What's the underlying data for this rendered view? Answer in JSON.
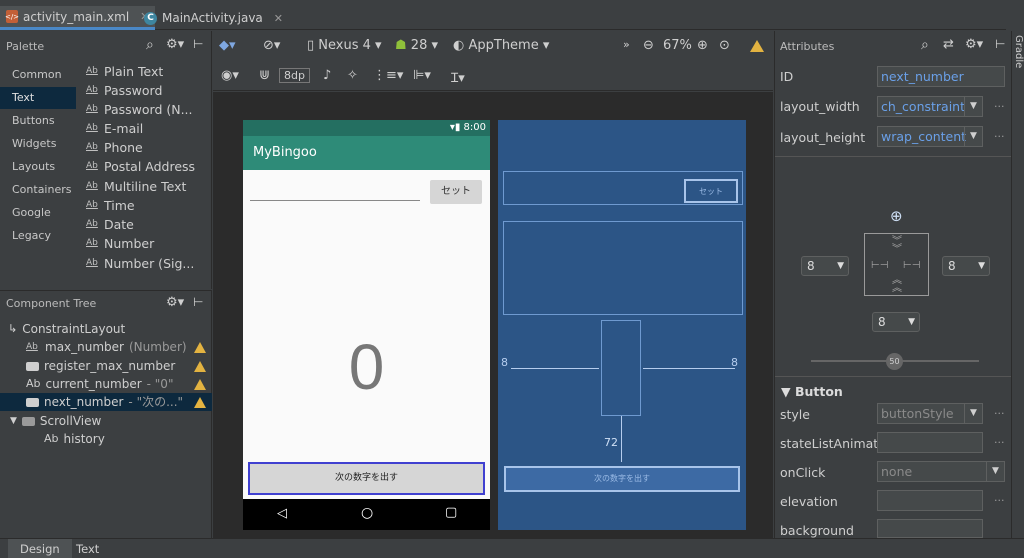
{
  "tabs": [
    {
      "label": "activity_main.xml",
      "icon": "xml-file-icon",
      "active": true
    },
    {
      "label": "MainActivity.java",
      "icon": "java-class-icon",
      "active": false
    }
  ],
  "palette": {
    "title": "Palette",
    "categories": [
      "Common",
      "Text",
      "Buttons",
      "Widgets",
      "Layouts",
      "Containers",
      "Google",
      "Legacy"
    ],
    "selected_category": "Text",
    "items": [
      "Plain Text",
      "Password",
      "Password (N...",
      "E-mail",
      "Phone",
      "Postal Address",
      "Multiline Text",
      "Time",
      "Date",
      "Number",
      "Number (Sig..."
    ]
  },
  "component_tree": {
    "title": "Component Tree",
    "rows": [
      {
        "name": "ConstraintLayout",
        "extra": ""
      },
      {
        "name": "max_number",
        "extra": "(Number)"
      },
      {
        "name": "register_max_number",
        "extra": ""
      },
      {
        "name": "current_number",
        "extra": "- \"0\""
      },
      {
        "name": "next_number",
        "extra": "- \"次の...\""
      },
      {
        "name": "ScrollView",
        "extra": ""
      },
      {
        "name": "history",
        "extra": ""
      }
    ]
  },
  "toolbar": {
    "device": "Nexus 4",
    "api": "28",
    "theme": "AppTheme",
    "zoom": "67%",
    "margin": "8dp",
    "more": "»"
  },
  "phone": {
    "time": "8:00",
    "app_title": "MyBingoo",
    "set_button": "セット",
    "big_number": "0",
    "bottom_button": "次の数字を出す"
  },
  "blueprint": {
    "set_button": "セット",
    "bottom_button": "次の数字を出す",
    "margin_left": "8",
    "margin_right": "8",
    "margin_bottom": "72"
  },
  "attributes": {
    "title": "Attributes",
    "id_label": "ID",
    "id_value": "next_number",
    "layout_width_label": "layout_width",
    "layout_width_value": "ch_constraint",
    "layout_height_label": "layout_height",
    "layout_height_value": "wrap_content",
    "margin_left": "8",
    "margin_right": "8",
    "margin_bottom": "8",
    "bias": "50",
    "section": "Button",
    "style_label": "style",
    "style_value": "buttonStyle",
    "state_label": "stateListAnimat",
    "onclick_label": "onClick",
    "onclick_value": "none",
    "elevation_label": "elevation",
    "background_label": "background"
  },
  "side_tab": "Gradle",
  "bottom_tabs": [
    {
      "label": "Design",
      "active": true
    },
    {
      "label": "Text",
      "active": false
    }
  ],
  "colors": {
    "app_bar": "#2e8b78",
    "status_bar": "#246f61",
    "blueprint": "#2c5586",
    "selection": "#4a88c7",
    "warning": "#e3b341"
  }
}
